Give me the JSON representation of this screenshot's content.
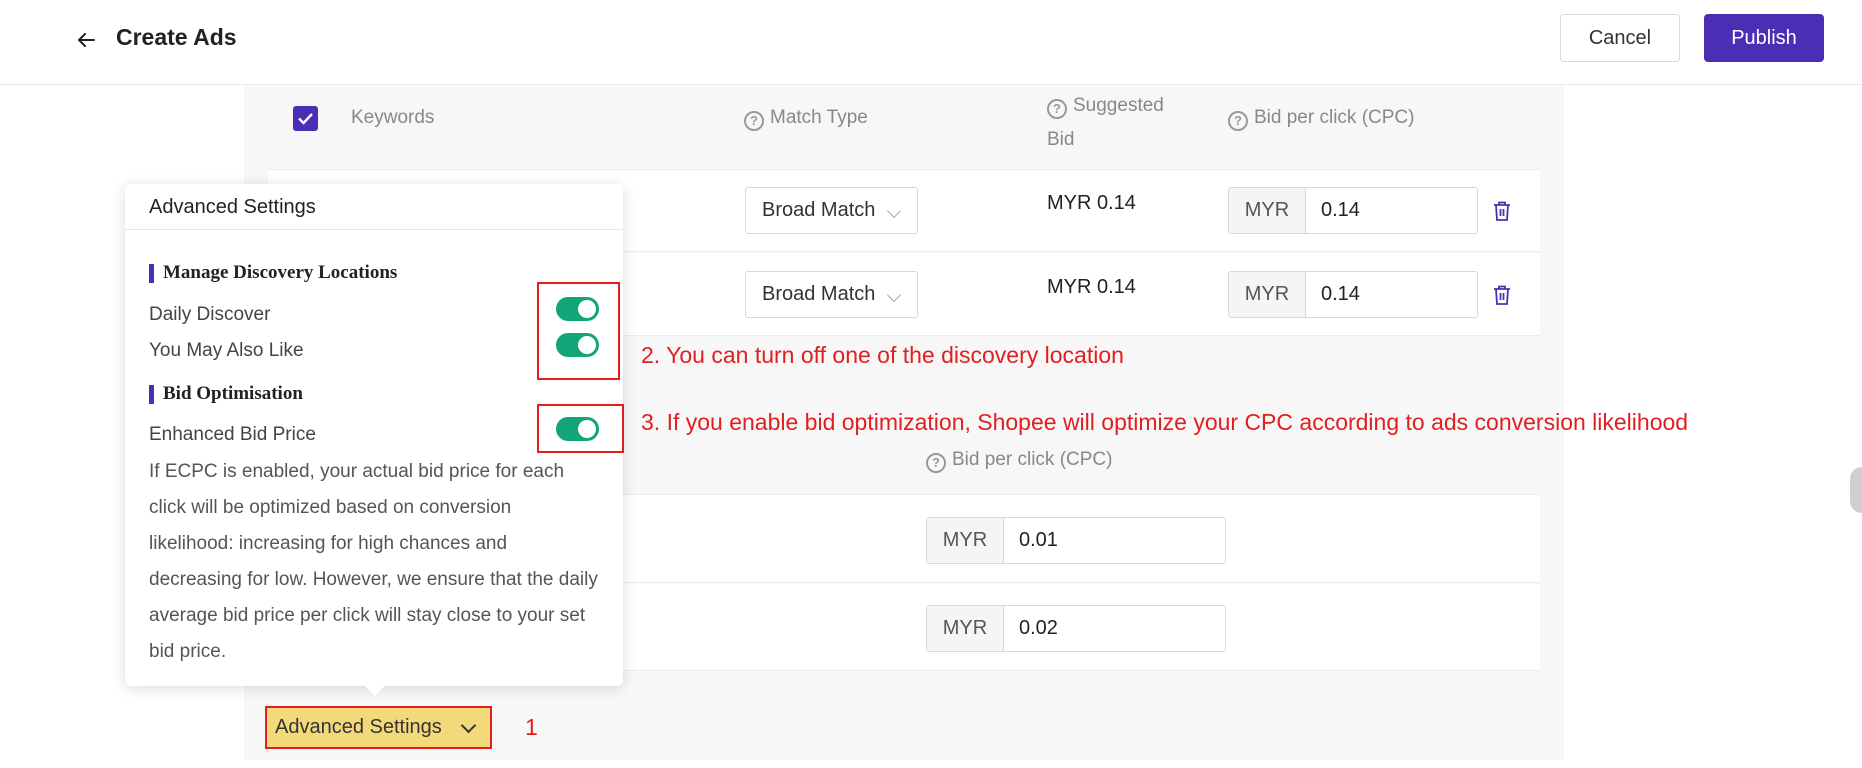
{
  "header": {
    "title": "Create Ads",
    "cancel_label": "Cancel",
    "publish_label": "Publish",
    "publish_color": "#4a2fb5"
  },
  "table1": {
    "col_keywords": "Keywords",
    "col_match_type": "Match Type",
    "col_suggested_bid_line1": "Suggested",
    "col_suggested_bid_line2": "Bid",
    "col_bid_per_click": "Bid per click (CPC)",
    "rows": [
      {
        "match_type": "Broad Match",
        "suggested_bid": "MYR 0.14",
        "currency": "MYR",
        "bid": "0.14"
      },
      {
        "match_type": "Broad Match",
        "suggested_bid": "MYR 0.14",
        "currency": "MYR",
        "bid": "0.14"
      }
    ]
  },
  "table2": {
    "col_bid_per_click": "Bid per click (CPC)",
    "rows": [
      {
        "currency": "MYR",
        "bid": "0.01"
      },
      {
        "currency": "MYR",
        "bid": "0.02"
      }
    ]
  },
  "popover": {
    "title": "Advanced Settings",
    "section_discovery": "Manage Discovery Locations",
    "daily_discover_label": "Daily Discover",
    "daily_discover_on": true,
    "you_may_also_like_label": "You May Also Like",
    "you_may_also_like_on": true,
    "section_bid": "Bid Optimisation",
    "enhanced_bid_label": "Enhanced Bid Price",
    "enhanced_bid_on": true,
    "description": "If ECPC is enabled, your actual bid price for each click will be optimized based on conversion likelihood: increasing for high chances and decreasing for low. However, we ensure that the daily average bid price per click will stay close to your set bid price.",
    "toggle_color": "#12a579"
  },
  "advanced_settings_button": "Advanced Settings",
  "annotations": {
    "step1": "1",
    "step2": "2. You can turn off one of the discovery location",
    "step3": "3. If you enable bid optimization, Shopee will optimize your CPC according to ads conversion likelihood",
    "color": "#e02020"
  }
}
